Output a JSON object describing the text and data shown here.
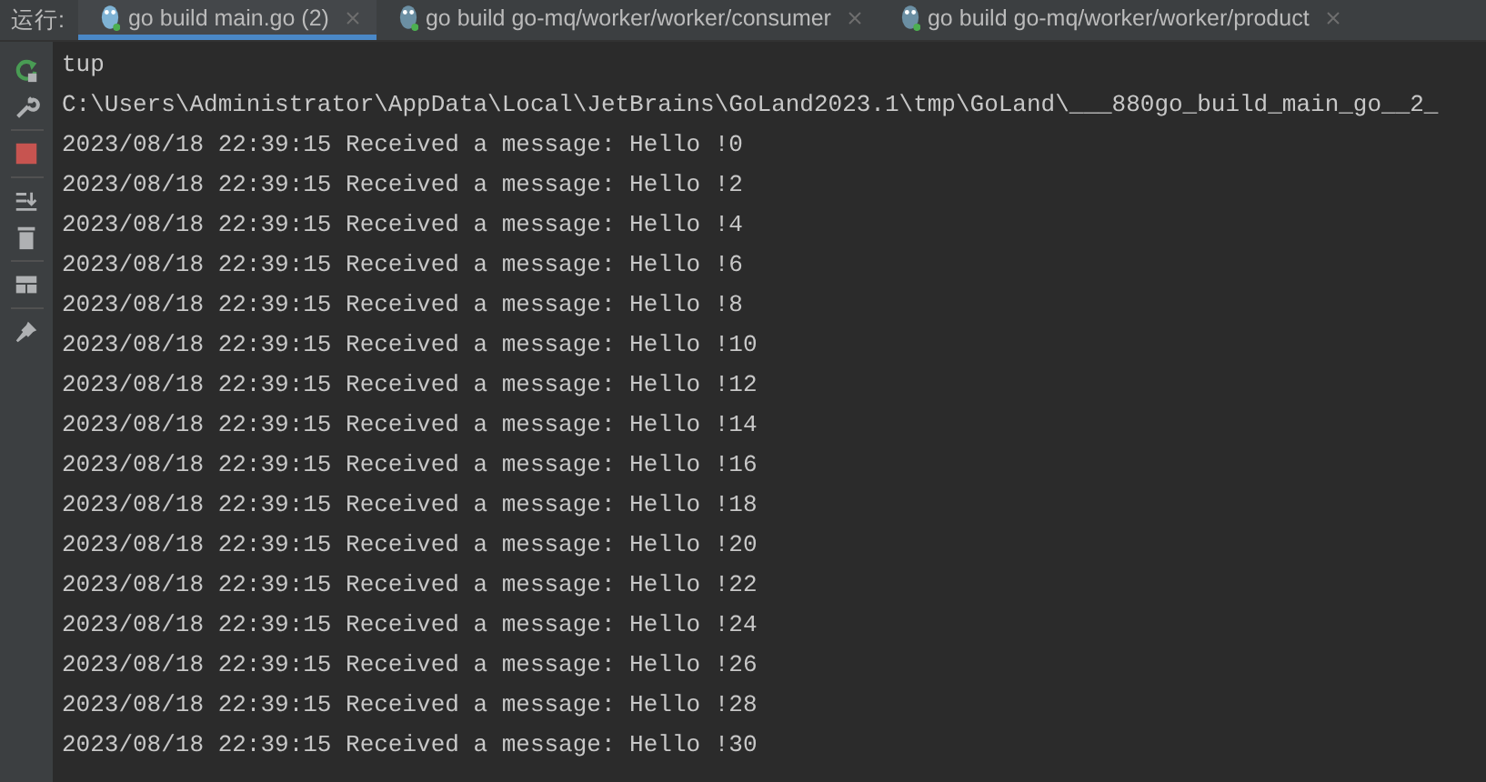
{
  "run_panel": {
    "label": "运行:",
    "tabs": [
      {
        "label": "go build main.go (2)",
        "selected": true
      },
      {
        "label": "go build go-mq/worker/worker/consumer",
        "selected": false
      },
      {
        "label": "go build go-mq/worker/worker/product",
        "selected": false
      }
    ]
  },
  "console": {
    "lines": [
      "tup",
      "C:\\Users\\Administrator\\AppData\\Local\\JetBrains\\GoLand2023.1\\tmp\\GoLand\\___880go_build_main_go__2_",
      "2023/08/18 22:39:15 Received a message: Hello !0",
      "2023/08/18 22:39:15 Received a message: Hello !2",
      "2023/08/18 22:39:15 Received a message: Hello !4",
      "2023/08/18 22:39:15 Received a message: Hello !6",
      "2023/08/18 22:39:15 Received a message: Hello !8",
      "2023/08/18 22:39:15 Received a message: Hello !10",
      "2023/08/18 22:39:15 Received a message: Hello !12",
      "2023/08/18 22:39:15 Received a message: Hello !14",
      "2023/08/18 22:39:15 Received a message: Hello !16",
      "2023/08/18 22:39:15 Received a message: Hello !18",
      "2023/08/18 22:39:15 Received a message: Hello !20",
      "2023/08/18 22:39:15 Received a message: Hello !22",
      "2023/08/18 22:39:15 Received a message: Hello !24",
      "2023/08/18 22:39:15 Received a message: Hello !26",
      "2023/08/18 22:39:15 Received a message: Hello !28",
      "2023/08/18 22:39:15 Received a message: Hello !30"
    ]
  }
}
